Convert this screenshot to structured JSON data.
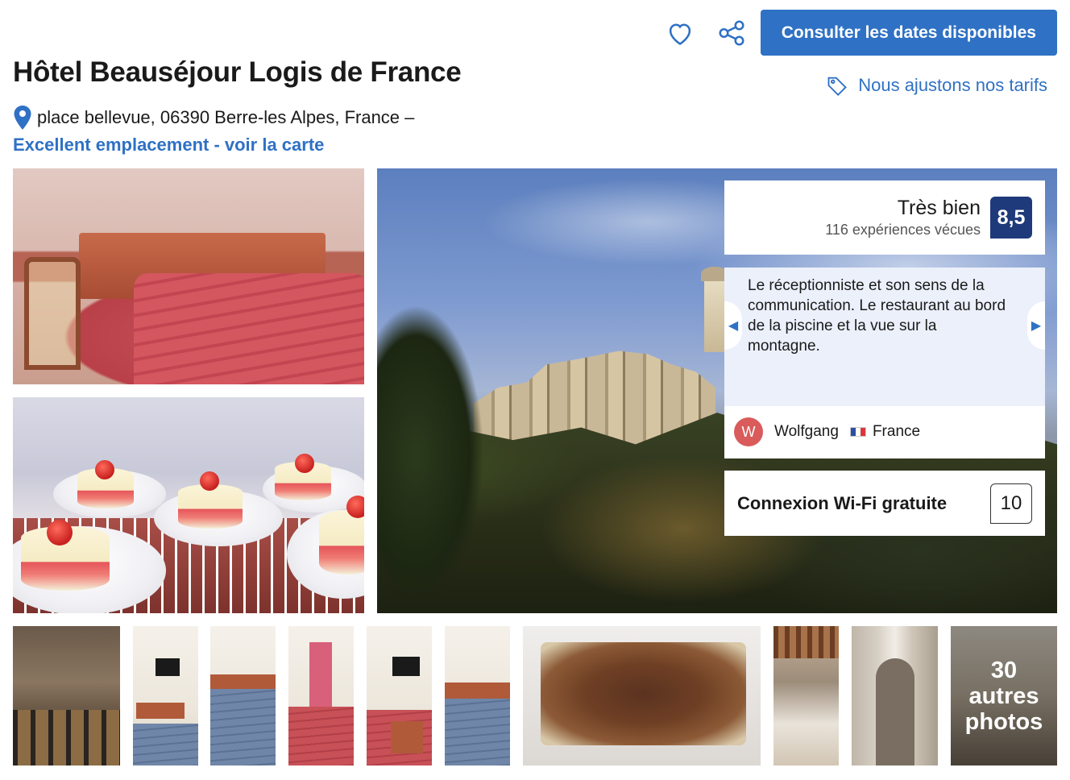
{
  "header": {
    "favorite_icon": "heart-icon",
    "share_icon": "share-icon",
    "cta_label": "Consulter les dates disponibles",
    "accent_color": "#2f71c4"
  },
  "hotel": {
    "name": "Hôtel Beauséjour Logis de France",
    "address": "place bellevue, 06390 Berre-les Alpes, France –",
    "location_link": "Excellent emplacement - voir la carte"
  },
  "price_match": {
    "icon": "tag-icon",
    "label": "Nous ajustons nos tarifs"
  },
  "score": {
    "label": "Très bien",
    "count": "116 expériences vécues",
    "value": "8,5",
    "badge_color": "#1e3a7a"
  },
  "review": {
    "text": "Le réceptionniste et son sens de la communication. Le restaurant au bord de la piscine et la vue sur la montagne.",
    "author_initial": "W",
    "author": "Wolfgang",
    "country": "France"
  },
  "facility": {
    "label": "Connexion Wi-Fi gratuite",
    "score": "10"
  },
  "gallery": {
    "more_count": "30",
    "more_line1": "autres",
    "more_line2": "photos"
  }
}
